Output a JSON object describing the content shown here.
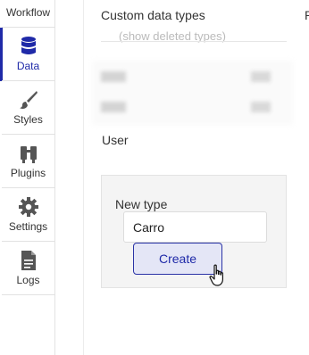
{
  "sidebar": {
    "items": [
      {
        "key": "workflow",
        "label": "Workflow",
        "icon": "workflow-icon",
        "active": false
      },
      {
        "key": "data",
        "label": "Data",
        "icon": "database-icon",
        "active": true
      },
      {
        "key": "styles",
        "label": "Styles",
        "icon": "brush-icon",
        "active": false
      },
      {
        "key": "plugins",
        "label": "Plugins",
        "icon": "plug-icon",
        "active": false
      },
      {
        "key": "settings",
        "label": "Settings",
        "icon": "gear-icon",
        "active": false
      },
      {
        "key": "logs",
        "label": "Logs",
        "icon": "document-icon",
        "active": false
      }
    ],
    "accent_color": "#1f2aa8"
  },
  "main": {
    "title": "Custom data types",
    "show_deleted_link": "(show deleted types)",
    "right_edge_partial_text": "P",
    "types": [
      "User"
    ],
    "new_type": {
      "label": "New type",
      "input_value": "Carro",
      "create_label": "Create"
    }
  }
}
